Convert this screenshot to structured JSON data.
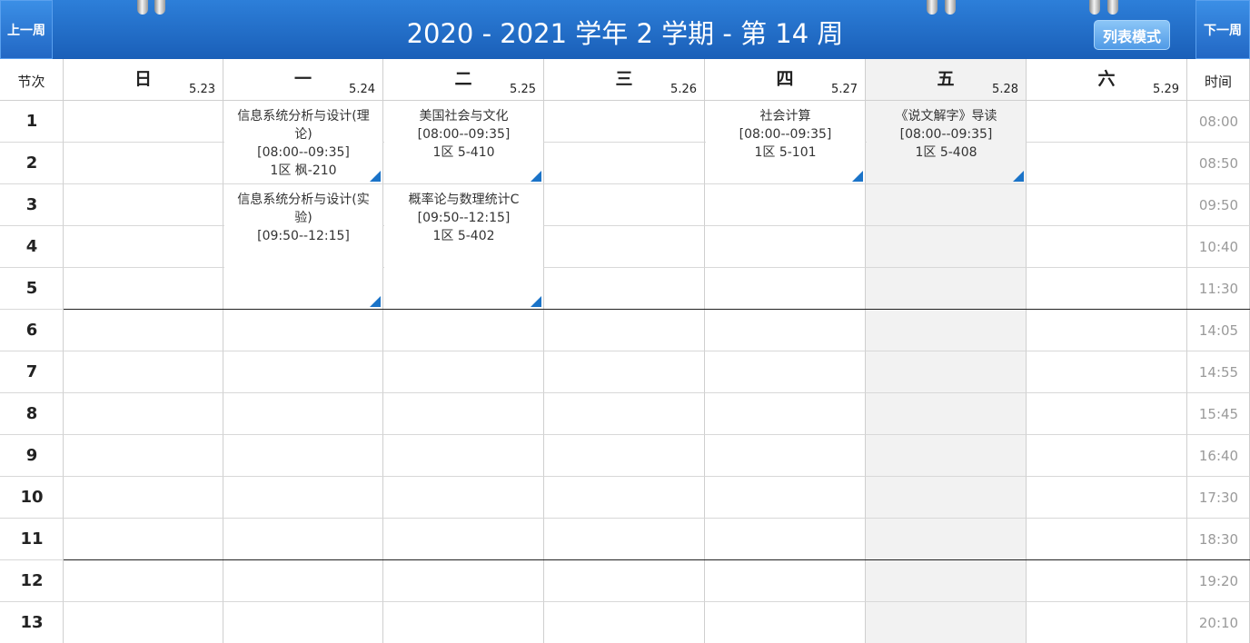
{
  "nav": {
    "prev_week": "上一周",
    "next_week": "下一周",
    "title": "2020 - 2021 学年 2 学期 - 第 14 周",
    "list_mode": "列表模式"
  },
  "table": {
    "corner_label": "节次",
    "time_header": "时间",
    "days": [
      {
        "name": "日",
        "date": "5.23"
      },
      {
        "name": "一",
        "date": "5.24"
      },
      {
        "name": "二",
        "date": "5.25"
      },
      {
        "name": "三",
        "date": "5.26"
      },
      {
        "name": "四",
        "date": "5.27"
      },
      {
        "name": "五",
        "date": "5.28"
      },
      {
        "name": "六",
        "date": "5.29"
      }
    ],
    "periods": [
      "1",
      "2",
      "3",
      "4",
      "5",
      "6",
      "7",
      "8",
      "9",
      "10",
      "11",
      "12",
      "13"
    ],
    "times": [
      "08:00",
      "08:50",
      "09:50",
      "10:40",
      "11:30",
      "14:05",
      "14:55",
      "15:45",
      "16:40",
      "17:30",
      "18:30",
      "19:20",
      "20:10"
    ],
    "highlight_day_index": 5
  },
  "courses": [
    {
      "name": "信息系统分析与设计(理论)",
      "time": "[08:00--09:35]",
      "room": "1区 枫-210",
      "day": 1
    },
    {
      "name": "信息系统分析与设计(实验)",
      "time": "[09:50--12:15]",
      "room": "",
      "day": 1
    },
    {
      "name": "美国社会与文化",
      "time": "[08:00--09:35]",
      "room": "1区 5-410",
      "day": 2
    },
    {
      "name": "概率论与数理统计C",
      "time": "[09:50--12:15]",
      "room": "1区 5-402",
      "day": 2
    },
    {
      "name": "社会计算",
      "time": "[08:00--09:35]",
      "room": "1区 5-101",
      "day": 4
    },
    {
      "name": "《说文解字》导读",
      "time": "[08:00--09:35]",
      "room": "1区 5-408",
      "day": 5
    }
  ],
  "colors": {
    "header": "#1a5fb8",
    "highlight_column": "#f2f2f2",
    "corner_marker": "#1a73c8"
  }
}
